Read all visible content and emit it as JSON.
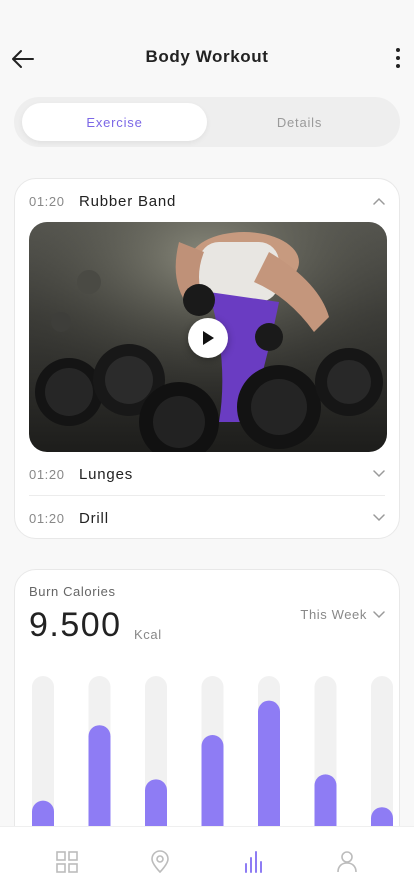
{
  "header": {
    "title": "Body Workout"
  },
  "tabs": [
    {
      "label": "Exercise",
      "active": true
    },
    {
      "label": "Details",
      "active": false
    }
  ],
  "exercises": [
    {
      "time": "01:20",
      "name": "Rubber Band",
      "expanded": true
    },
    {
      "time": "01:20",
      "name": "Lunges",
      "expanded": false
    },
    {
      "time": "01:20",
      "name": "Drill",
      "expanded": false
    }
  ],
  "calories": {
    "title": "Burn Calories",
    "value": "9.500",
    "unit": "Kcal",
    "period": "This Week"
  },
  "chart_data": {
    "type": "bar",
    "categories": [],
    "values": [
      0.24,
      0.7,
      0.37,
      0.64,
      0.85,
      0.4,
      0.2
    ],
    "ylim": [
      0,
      1
    ],
    "bar_color": "#8e7cf4",
    "track_color": "#f1f1f1"
  },
  "nav": [
    {
      "icon": "dashboard-icon",
      "active": false
    },
    {
      "icon": "location-icon",
      "active": false
    },
    {
      "icon": "stats-icon",
      "active": true
    },
    {
      "icon": "profile-icon",
      "active": false
    }
  ],
  "colors": {
    "accent": "#7b67e6",
    "bar": "#8e7cf4",
    "inactive_icon": "#bcbcbc"
  }
}
